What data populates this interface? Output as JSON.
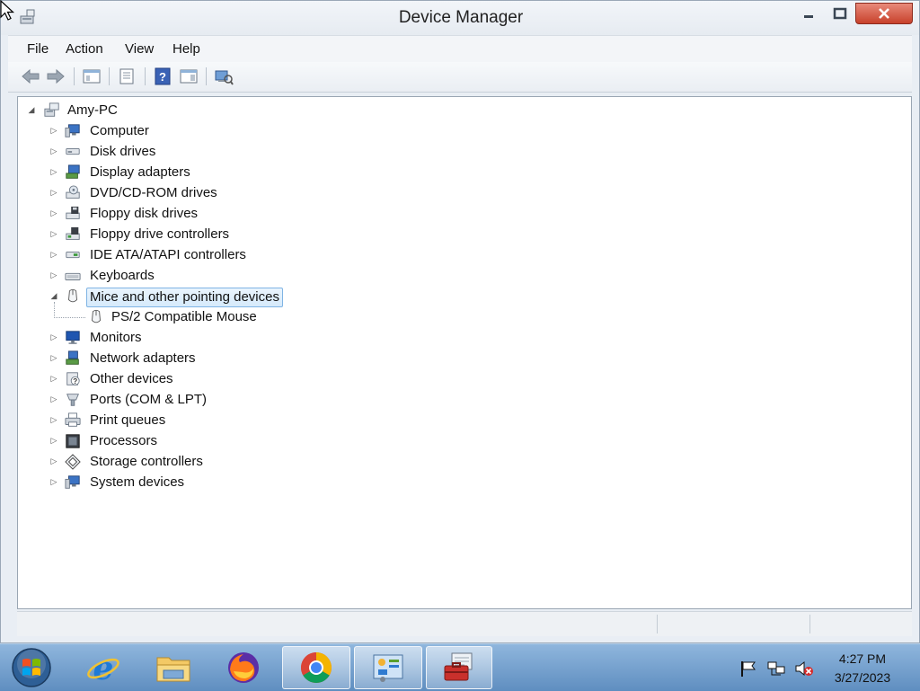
{
  "window": {
    "title": "Device Manager"
  },
  "menu": [
    "File",
    "Action",
    "View",
    "Help"
  ],
  "toolbar": {
    "buttons": [
      "back-icon",
      "forward-icon",
      "show-hide-console-tree-icon",
      "properties-icon",
      "help-icon",
      "action-pane-icon",
      "scan-hardware-icon"
    ]
  },
  "tree": {
    "root": "Amy-PC",
    "items": [
      {
        "label": "Computer",
        "icon": "computer-icon",
        "expanded": false
      },
      {
        "label": "Disk drives",
        "icon": "disk-drive-icon",
        "expanded": false
      },
      {
        "label": "Display adapters",
        "icon": "display-adapter-icon",
        "expanded": false
      },
      {
        "label": "DVD/CD-ROM drives",
        "icon": "dvd-drive-icon",
        "expanded": false
      },
      {
        "label": "Floppy disk drives",
        "icon": "floppy-disk-icon",
        "expanded": false
      },
      {
        "label": "Floppy drive controllers",
        "icon": "floppy-controller-icon",
        "expanded": false
      },
      {
        "label": "IDE ATA/ATAPI controllers",
        "icon": "ide-controller-icon",
        "expanded": false
      },
      {
        "label": "Keyboards",
        "icon": "keyboard-icon",
        "expanded": false
      },
      {
        "label": "Mice and other pointing devices",
        "icon": "mouse-icon",
        "expanded": true,
        "selected": true,
        "children": [
          {
            "label": "PS/2 Compatible Mouse",
            "icon": "mouse-icon"
          }
        ]
      },
      {
        "label": "Monitors",
        "icon": "monitor-icon",
        "expanded": false
      },
      {
        "label": "Network adapters",
        "icon": "network-adapter-icon",
        "expanded": false
      },
      {
        "label": "Other devices",
        "icon": "other-devices-icon",
        "expanded": false
      },
      {
        "label": "Ports (COM & LPT)",
        "icon": "port-icon",
        "expanded": false
      },
      {
        "label": "Print queues",
        "icon": "printer-icon",
        "expanded": false
      },
      {
        "label": "Processors",
        "icon": "processor-icon",
        "expanded": false
      },
      {
        "label": "Storage controllers",
        "icon": "storage-controller-icon",
        "expanded": false
      },
      {
        "label": "System devices",
        "icon": "system-devices-icon",
        "expanded": false
      }
    ]
  },
  "taskbar": {
    "apps": [
      "internet-explorer-icon",
      "file-explorer-icon",
      "firefox-icon",
      "chrome-icon",
      "control-panel-icon",
      "device-manager-icon"
    ],
    "tray": [
      "action-center-flag-icon",
      "network-icon",
      "volume-muted-icon"
    ],
    "time": "4:27 PM",
    "date": "3/27/2023"
  },
  "colors": {
    "selection_border": "#7fb4e4",
    "close_button": "#c8412b",
    "taskbar": "#6f9acb"
  }
}
